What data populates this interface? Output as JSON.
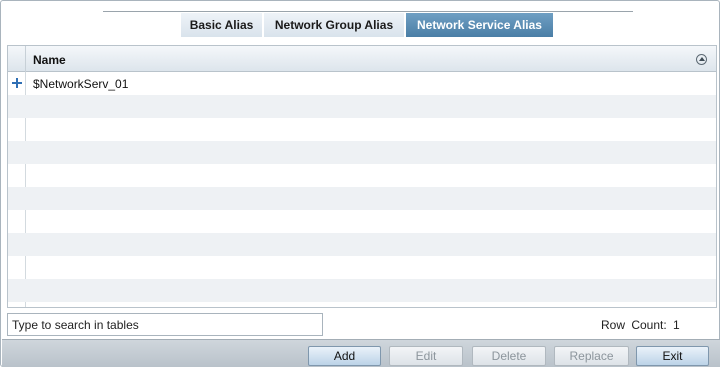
{
  "tabs": [
    {
      "label": "Basic Alias",
      "active": false
    },
    {
      "label": "Network Group Alias",
      "active": false
    },
    {
      "label": "Network Service Alias",
      "active": true
    }
  ],
  "table": {
    "columns": [
      "Name"
    ],
    "rows": [
      {
        "name": "$NetworkServ_01"
      }
    ]
  },
  "search": {
    "placeholder": "Type to search in tables",
    "value": ""
  },
  "status": {
    "row_count_label": "Row Count:",
    "row_count_value": "1"
  },
  "buttons": {
    "add": "Add",
    "edit": "Edit",
    "delete": "Delete",
    "replace": "Replace",
    "exit": "Exit"
  },
  "colors": {
    "active_tab": "#4a7ea6",
    "expand_icon": "#2f6fb4"
  }
}
